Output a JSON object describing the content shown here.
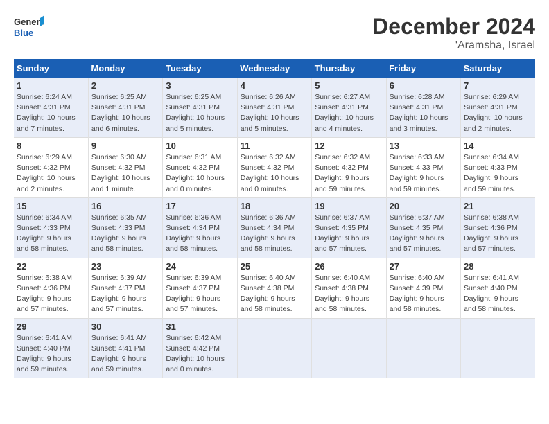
{
  "header": {
    "logo_line1": "General",
    "logo_line2": "Blue",
    "title": "December 2024",
    "subtitle": "'Aramsha, Israel"
  },
  "days_of_week": [
    "Sunday",
    "Monday",
    "Tuesday",
    "Wednesday",
    "Thursday",
    "Friday",
    "Saturday"
  ],
  "weeks": [
    [
      {
        "day": "1",
        "sunrise": "Sunrise: 6:24 AM",
        "sunset": "Sunset: 4:31 PM",
        "daylight": "Daylight: 10 hours and 7 minutes."
      },
      {
        "day": "2",
        "sunrise": "Sunrise: 6:25 AM",
        "sunset": "Sunset: 4:31 PM",
        "daylight": "Daylight: 10 hours and 6 minutes."
      },
      {
        "day": "3",
        "sunrise": "Sunrise: 6:25 AM",
        "sunset": "Sunset: 4:31 PM",
        "daylight": "Daylight: 10 hours and 5 minutes."
      },
      {
        "day": "4",
        "sunrise": "Sunrise: 6:26 AM",
        "sunset": "Sunset: 4:31 PM",
        "daylight": "Daylight: 10 hours and 5 minutes."
      },
      {
        "day": "5",
        "sunrise": "Sunrise: 6:27 AM",
        "sunset": "Sunset: 4:31 PM",
        "daylight": "Daylight: 10 hours and 4 minutes."
      },
      {
        "day": "6",
        "sunrise": "Sunrise: 6:28 AM",
        "sunset": "Sunset: 4:31 PM",
        "daylight": "Daylight: 10 hours and 3 minutes."
      },
      {
        "day": "7",
        "sunrise": "Sunrise: 6:29 AM",
        "sunset": "Sunset: 4:31 PM",
        "daylight": "Daylight: 10 hours and 2 minutes."
      }
    ],
    [
      {
        "day": "8",
        "sunrise": "Sunrise: 6:29 AM",
        "sunset": "Sunset: 4:32 PM",
        "daylight": "Daylight: 10 hours and 2 minutes."
      },
      {
        "day": "9",
        "sunrise": "Sunrise: 6:30 AM",
        "sunset": "Sunset: 4:32 PM",
        "daylight": "Daylight: 10 hours and 1 minute."
      },
      {
        "day": "10",
        "sunrise": "Sunrise: 6:31 AM",
        "sunset": "Sunset: 4:32 PM",
        "daylight": "Daylight: 10 hours and 0 minutes."
      },
      {
        "day": "11",
        "sunrise": "Sunrise: 6:32 AM",
        "sunset": "Sunset: 4:32 PM",
        "daylight": "Daylight: 10 hours and 0 minutes."
      },
      {
        "day": "12",
        "sunrise": "Sunrise: 6:32 AM",
        "sunset": "Sunset: 4:32 PM",
        "daylight": "Daylight: 9 hours and 59 minutes."
      },
      {
        "day": "13",
        "sunrise": "Sunrise: 6:33 AM",
        "sunset": "Sunset: 4:33 PM",
        "daylight": "Daylight: 9 hours and 59 minutes."
      },
      {
        "day": "14",
        "sunrise": "Sunrise: 6:34 AM",
        "sunset": "Sunset: 4:33 PM",
        "daylight": "Daylight: 9 hours and 59 minutes."
      }
    ],
    [
      {
        "day": "15",
        "sunrise": "Sunrise: 6:34 AM",
        "sunset": "Sunset: 4:33 PM",
        "daylight": "Daylight: 9 hours and 58 minutes."
      },
      {
        "day": "16",
        "sunrise": "Sunrise: 6:35 AM",
        "sunset": "Sunset: 4:33 PM",
        "daylight": "Daylight: 9 hours and 58 minutes."
      },
      {
        "day": "17",
        "sunrise": "Sunrise: 6:36 AM",
        "sunset": "Sunset: 4:34 PM",
        "daylight": "Daylight: 9 hours and 58 minutes."
      },
      {
        "day": "18",
        "sunrise": "Sunrise: 6:36 AM",
        "sunset": "Sunset: 4:34 PM",
        "daylight": "Daylight: 9 hours and 58 minutes."
      },
      {
        "day": "19",
        "sunrise": "Sunrise: 6:37 AM",
        "sunset": "Sunset: 4:35 PM",
        "daylight": "Daylight: 9 hours and 57 minutes."
      },
      {
        "day": "20",
        "sunrise": "Sunrise: 6:37 AM",
        "sunset": "Sunset: 4:35 PM",
        "daylight": "Daylight: 9 hours and 57 minutes."
      },
      {
        "day": "21",
        "sunrise": "Sunrise: 6:38 AM",
        "sunset": "Sunset: 4:36 PM",
        "daylight": "Daylight: 9 hours and 57 minutes."
      }
    ],
    [
      {
        "day": "22",
        "sunrise": "Sunrise: 6:38 AM",
        "sunset": "Sunset: 4:36 PM",
        "daylight": "Daylight: 9 hours and 57 minutes."
      },
      {
        "day": "23",
        "sunrise": "Sunrise: 6:39 AM",
        "sunset": "Sunset: 4:37 PM",
        "daylight": "Daylight: 9 hours and 57 minutes."
      },
      {
        "day": "24",
        "sunrise": "Sunrise: 6:39 AM",
        "sunset": "Sunset: 4:37 PM",
        "daylight": "Daylight: 9 hours and 57 minutes."
      },
      {
        "day": "25",
        "sunrise": "Sunrise: 6:40 AM",
        "sunset": "Sunset: 4:38 PM",
        "daylight": "Daylight: 9 hours and 58 minutes."
      },
      {
        "day": "26",
        "sunrise": "Sunrise: 6:40 AM",
        "sunset": "Sunset: 4:38 PM",
        "daylight": "Daylight: 9 hours and 58 minutes."
      },
      {
        "day": "27",
        "sunrise": "Sunrise: 6:40 AM",
        "sunset": "Sunset: 4:39 PM",
        "daylight": "Daylight: 9 hours and 58 minutes."
      },
      {
        "day": "28",
        "sunrise": "Sunrise: 6:41 AM",
        "sunset": "Sunset: 4:40 PM",
        "daylight": "Daylight: 9 hours and 58 minutes."
      }
    ],
    [
      {
        "day": "29",
        "sunrise": "Sunrise: 6:41 AM",
        "sunset": "Sunset: 4:40 PM",
        "daylight": "Daylight: 9 hours and 59 minutes."
      },
      {
        "day": "30",
        "sunrise": "Sunrise: 6:41 AM",
        "sunset": "Sunset: 4:41 PM",
        "daylight": "Daylight: 9 hours and 59 minutes."
      },
      {
        "day": "31",
        "sunrise": "Sunrise: 6:42 AM",
        "sunset": "Sunset: 4:42 PM",
        "daylight": "Daylight: 10 hours and 0 minutes."
      },
      null,
      null,
      null,
      null
    ]
  ]
}
